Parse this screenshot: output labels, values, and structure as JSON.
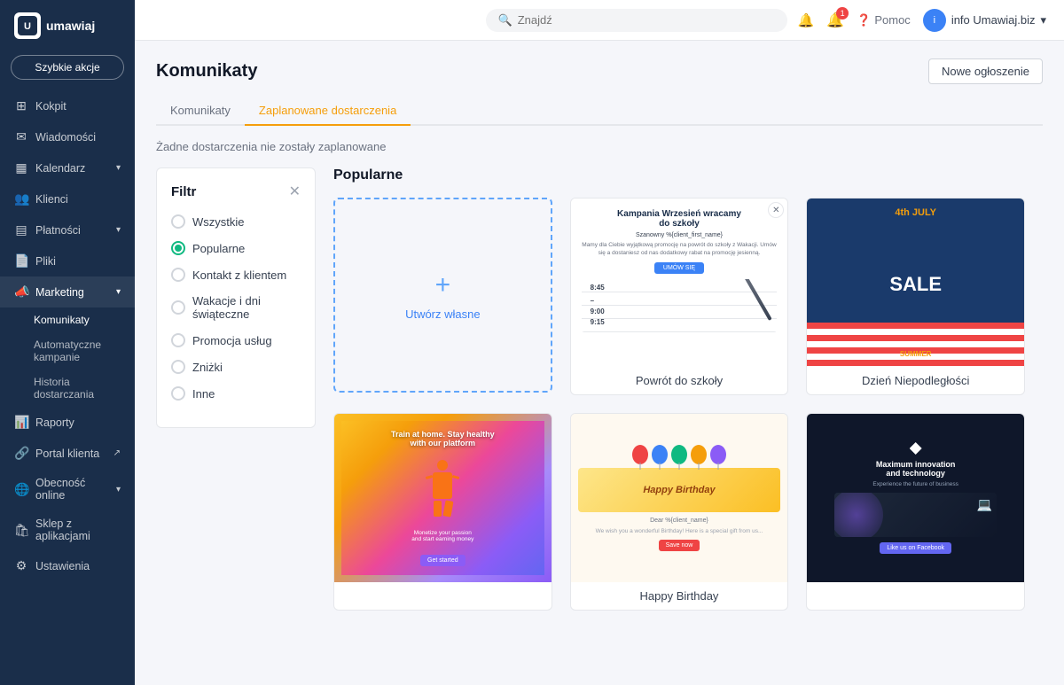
{
  "app": {
    "logo_text": "umawiaj",
    "logo_abbr": "U"
  },
  "sidebar": {
    "quick_action_label": "Szybkie akcje",
    "nav_items": [
      {
        "id": "kokpit",
        "label": "Kokpit",
        "icon": "⊞",
        "has_chevron": false
      },
      {
        "id": "wiadomosci",
        "label": "Wiadomości",
        "icon": "✉",
        "has_chevron": false
      },
      {
        "id": "kalendarz",
        "label": "Kalendarz",
        "icon": "📅",
        "has_chevron": true
      },
      {
        "id": "klienci",
        "label": "Klienci",
        "icon": "👥",
        "has_chevron": false
      },
      {
        "id": "platnosci",
        "label": "Płatności",
        "icon": "💳",
        "has_chevron": true
      },
      {
        "id": "pliki",
        "label": "Pliki",
        "icon": "📄",
        "has_chevron": false
      },
      {
        "id": "marketing",
        "label": "Marketing",
        "icon": "📣",
        "has_chevron": true,
        "active": true
      }
    ],
    "marketing_subitems": [
      {
        "id": "komunikaty",
        "label": "Komunikaty",
        "active": true
      },
      {
        "id": "automatyczne",
        "label": "Automatyczne kampanie"
      },
      {
        "id": "historia",
        "label": "Historia dostarczania"
      }
    ],
    "bottom_nav": [
      {
        "id": "raporty",
        "label": "Raporty",
        "icon": "📊"
      },
      {
        "id": "portal",
        "label": "Portal klienta",
        "icon": "🔗",
        "external": true
      },
      {
        "id": "obecnosc",
        "label": "Obecność online",
        "icon": "🌐",
        "has_chevron": true
      },
      {
        "id": "sklep",
        "label": "Sklep z aplikacjami",
        "icon": "🛍"
      },
      {
        "id": "ustawienia",
        "label": "Ustawienia",
        "icon": "⚙"
      }
    ]
  },
  "topbar": {
    "search_placeholder": "Znajdź",
    "notification_count": "1",
    "help_label": "Pomoc",
    "user_label": "info Umawiaj.biz"
  },
  "page": {
    "title": "Komunikaty",
    "new_announcement_label": "Nowe ogłoszenie",
    "tabs": [
      {
        "id": "komunikaty",
        "label": "Komunikaty"
      },
      {
        "id": "zaplanowane",
        "label": "Zaplanowane dostarczenia",
        "active": true
      }
    ],
    "no_deliveries_text": "Żadne dostarczenia nie zostały zaplanowane"
  },
  "filter": {
    "title": "Filtr",
    "options": [
      {
        "id": "wszystkie",
        "label": "Wszystkie",
        "selected": false
      },
      {
        "id": "popularne",
        "label": "Popularne",
        "selected": true
      },
      {
        "id": "kontakt",
        "label": "Kontakt z klientem",
        "selected": false
      },
      {
        "id": "wakacje",
        "label": "Wakacje i dni świąteczne",
        "selected": false
      },
      {
        "id": "promocja",
        "label": "Promocja usług",
        "selected": false
      },
      {
        "id": "znizki",
        "label": "Zniżki",
        "selected": false
      },
      {
        "id": "inne",
        "label": "Inne",
        "selected": false
      }
    ]
  },
  "templates": {
    "section_title": "Popularne",
    "create_own_label": "Utwórz własne",
    "cards": [
      {
        "id": "create_own",
        "type": "create_own",
        "label": "Utwórz własne"
      },
      {
        "id": "back_to_school",
        "type": "back_to_school",
        "label": "Powrót do szkoły",
        "preview": {
          "title": "Kampania Wrzesień wracamy do szkoły",
          "greeting": "Szanowny %{client_first_name}",
          "body": "Mamy dla Ciebie wyjątkową promocję na powrót do szkoły z Wakacji. Umów się a dostaniesz od nas dodatkowy rabat na promocję jesienną.",
          "cta": "UMÓW SIĘ"
        }
      },
      {
        "id": "independence",
        "type": "independence",
        "label": "Dzień Niepodległości"
      },
      {
        "id": "fitness",
        "type": "fitness",
        "label": ""
      },
      {
        "id": "birthday",
        "type": "birthday",
        "label": "Happy Birthday"
      },
      {
        "id": "tech",
        "type": "tech",
        "label": ""
      }
    ]
  }
}
